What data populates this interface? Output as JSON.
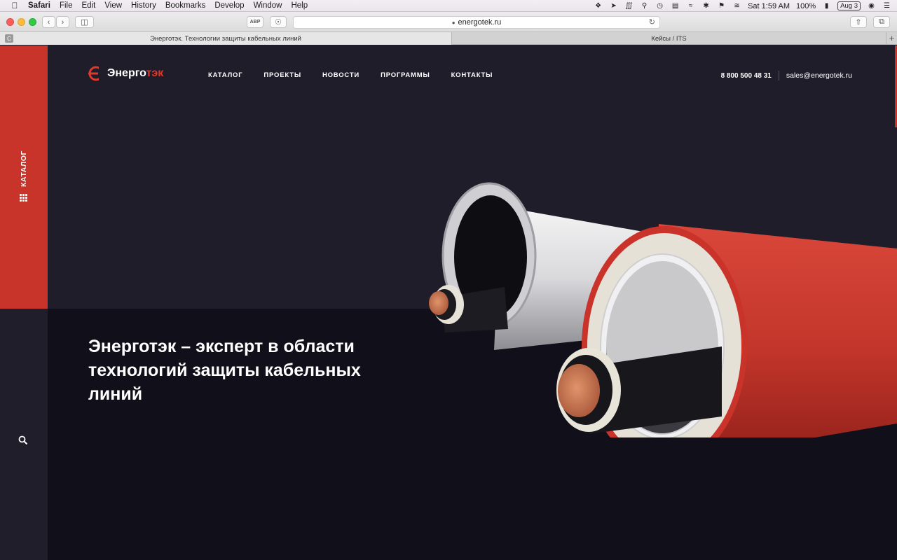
{
  "menubar": {
    "app": "Safari",
    "items": [
      "File",
      "Edit",
      "View",
      "History",
      "Bookmarks",
      "Develop",
      "Window",
      "Help"
    ],
    "clock": "Sat 1:59 AM",
    "battery": "100%",
    "date_badge": "Aug 3"
  },
  "browser": {
    "url": "energotek.ru",
    "tabs": [
      {
        "title": "Энерготэк. Технологии защиты кабельных линий",
        "active": true
      },
      {
        "title": "Кейсы / ITS",
        "active": false
      }
    ]
  },
  "site": {
    "logo_main": "Энерго",
    "logo_accent": "тэк",
    "side_catalog": "КАТАЛОГ",
    "nav": [
      "КАТАЛОГ",
      "ПРОЕКТЫ",
      "НОВОСТИ",
      "ПРОГРАММЫ",
      "КОНТАКТЫ"
    ],
    "phone": "8 800 500 48 31",
    "email": "sales@energotek.ru",
    "hero_title": "Энерготэк – эксперт в области технологий защиты кабельных линий"
  },
  "colors": {
    "accent": "#c8342a",
    "page_bg": "#1e1d29",
    "lower_bg": "#11101a"
  }
}
